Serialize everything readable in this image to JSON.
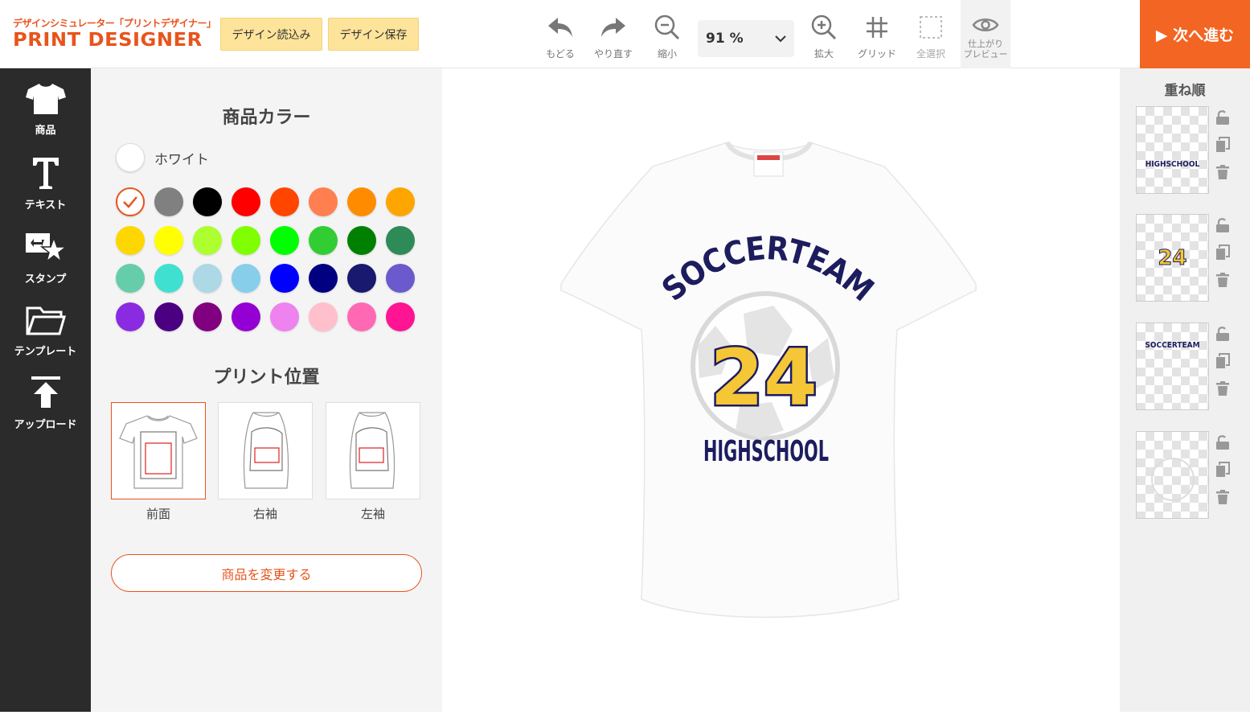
{
  "header": {
    "logo_sub": "デザインシミュレーター「プリントデザイナー」",
    "logo_main": "PRINT DESIGNER",
    "load_label": "デザイン読込み",
    "save_label": "デザイン保存",
    "undo_label": "もどる",
    "redo_label": "やり直す",
    "zoom_out_label": "縮小",
    "zoom_value": "91 %",
    "zoom_in_label": "拡大",
    "grid_label": "グリッド",
    "select_all_label": "全選択",
    "preview_label_1": "仕上がり",
    "preview_label_2": "プレビュー",
    "next_label": "▶ 次へ進む"
  },
  "rail": {
    "items": [
      {
        "label": "商品",
        "icon": "tshirt-icon"
      },
      {
        "label": "テキスト",
        "icon": "text-icon"
      },
      {
        "label": "スタンプ",
        "icon": "stamp-icon"
      },
      {
        "label": "テンプレート",
        "icon": "folder-icon"
      },
      {
        "label": "アップロード",
        "icon": "upload-icon"
      }
    ]
  },
  "panel": {
    "color_title": "商品カラー",
    "selected_color_name": "ホワイト",
    "colors": [
      "#ffffff",
      "#808080",
      "#000000",
      "#ff0000",
      "#ff4500",
      "#ff7f50",
      "#ff8c00",
      "#ffa500",
      "#ffd700",
      "#ffff00",
      "#adff2f",
      "#7fff00",
      "#00ff00",
      "#32cd32",
      "#008000",
      "#2e8b57",
      "#66cdaa",
      "#40e0d0",
      "#add8e6",
      "#87ceeb",
      "#0000ff",
      "#000080",
      "#191970",
      "#6a5acd",
      "#8a2be2",
      "#4b0082",
      "#800080",
      "#9400d3",
      "#ee82ee",
      "#ffc0cb",
      "#ff69b4",
      "#ff1493"
    ],
    "position_title": "プリント位置",
    "positions": [
      "前面",
      "右袖",
      "左袖"
    ],
    "change_label": "商品を変更する"
  },
  "design": {
    "arc_text": "SOCCERTEAM",
    "number": "24",
    "bottom_text": "HIGHSCHOOL"
  },
  "layers": {
    "title": "重ね順",
    "items": [
      {
        "preview": "HIGHSCHOOL"
      },
      {
        "preview": "24"
      },
      {
        "preview": "SOCCERTEAM"
      },
      {
        "preview": "ball"
      }
    ]
  },
  "colors": {
    "accent": "#f26522",
    "navy": "#1c1c5e",
    "gold": "#f5c635"
  }
}
